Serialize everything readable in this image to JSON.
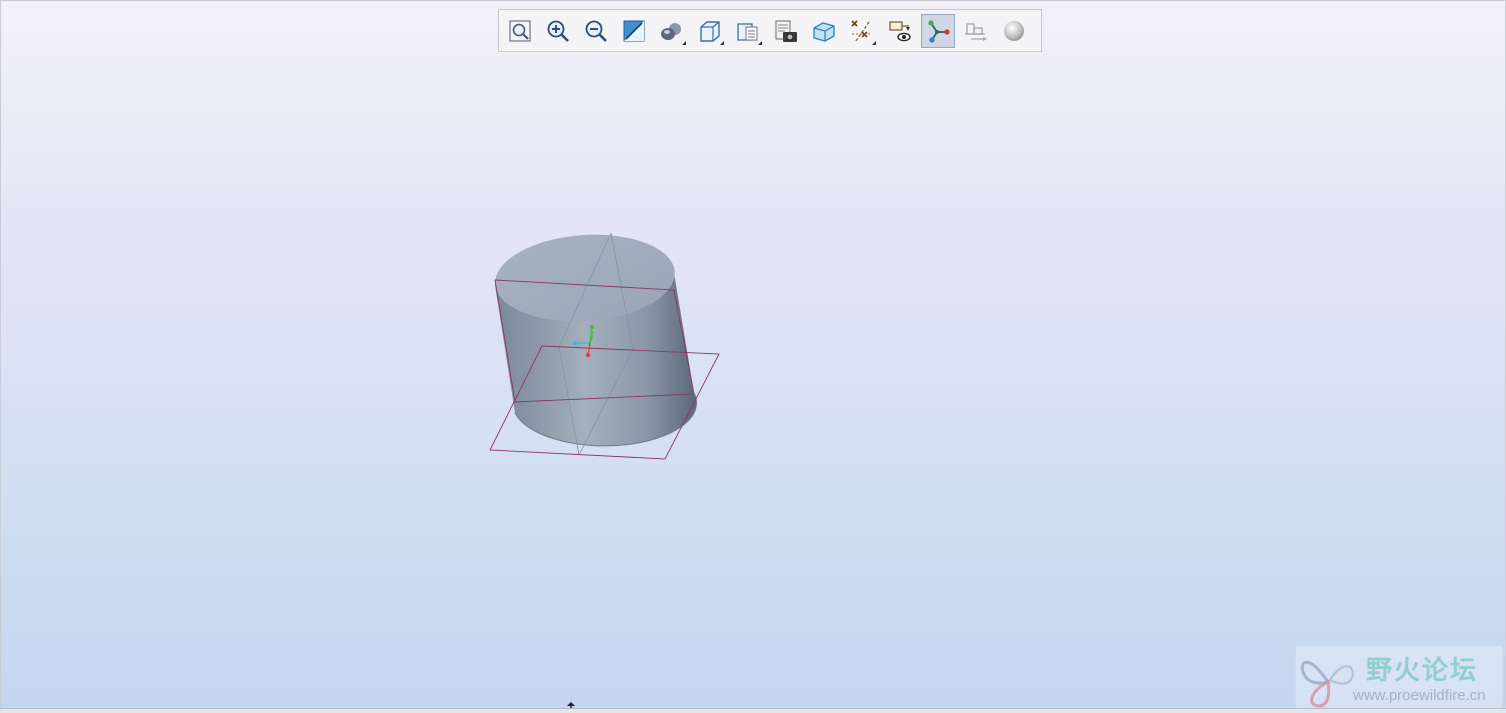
{
  "toolbar": {
    "tools": [
      {
        "name": "refit-icon",
        "flyout": false,
        "active": false
      },
      {
        "name": "zoom-in-icon",
        "flyout": false,
        "active": false
      },
      {
        "name": "zoom-out-icon",
        "flyout": false,
        "active": false
      },
      {
        "name": "repaint-icon",
        "flyout": false,
        "active": false
      },
      {
        "name": "display-style-icon",
        "flyout": true,
        "active": false
      },
      {
        "name": "saved-orientations-icon",
        "flyout": true,
        "active": false
      },
      {
        "name": "view-manager-icon",
        "flyout": true,
        "active": false
      },
      {
        "name": "view-snapshot-icon",
        "flyout": false,
        "active": false
      },
      {
        "name": "section-view-icon",
        "flyout": false,
        "active": false
      },
      {
        "name": "datum-display-icon",
        "flyout": true,
        "active": false
      },
      {
        "name": "annotation-display-icon",
        "flyout": false,
        "active": false
      },
      {
        "name": "spin-center-icon",
        "flyout": false,
        "active": true
      },
      {
        "name": "view-align-icon",
        "flyout": false,
        "active": false
      },
      {
        "name": "appearance-sphere-icon",
        "flyout": false,
        "active": false
      }
    ]
  },
  "colors": {
    "cylinder_top": "#a1aebd",
    "cylinder_side_dark": "#5d6a79",
    "cylinder_side_light": "#9aa6b4",
    "datum_plane": "#8a3a5a",
    "axis_x": "#e04040",
    "axis_y": "#40c040",
    "axis_z": "#40b8d8"
  },
  "watermark": {
    "title": "野火论坛",
    "url": "www.proewildfire.cn"
  }
}
